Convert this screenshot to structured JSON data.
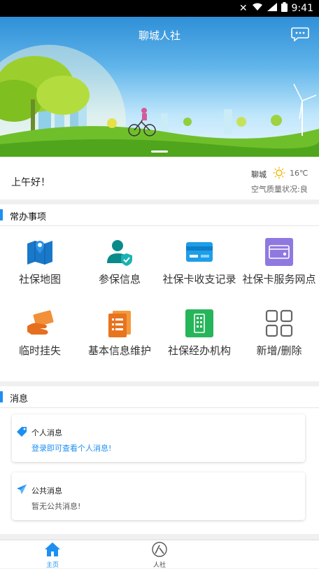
{
  "status_bar": {
    "time": "9:41"
  },
  "header": {
    "title": "聊城人社"
  },
  "greeting": {
    "text": "上午好！",
    "city": "聊城",
    "temperature": "16℃",
    "air_quality": "空气质量状况:良"
  },
  "common_tasks": {
    "title": "常办事项",
    "items": [
      {
        "label": "社保地图",
        "icon": "map-icon"
      },
      {
        "label": "参保信息",
        "icon": "user-shield-icon"
      },
      {
        "label": "社保卡收支记录",
        "icon": "card-icon"
      },
      {
        "label": "社保卡服务网点",
        "icon": "card-outlet-icon"
      },
      {
        "label": "临时挂失",
        "icon": "hand-card-icon"
      },
      {
        "label": "基本信息维护",
        "icon": "document-icon"
      },
      {
        "label": "社保经办机构",
        "icon": "building-icon"
      },
      {
        "label": "新增/删除",
        "icon": "grid-icon"
      }
    ]
  },
  "messages": {
    "title": "消息",
    "personal": {
      "title": "个人消息",
      "text": "登录即可查看个人消息!"
    },
    "public": {
      "title": "公共消息",
      "text": "暂无公共消息!"
    }
  },
  "bottom_nav": {
    "tabs": [
      {
        "label": "主页",
        "active": true
      },
      {
        "label": "人社",
        "active": false
      }
    ]
  },
  "colors": {
    "accent": "#1e8ff2"
  }
}
